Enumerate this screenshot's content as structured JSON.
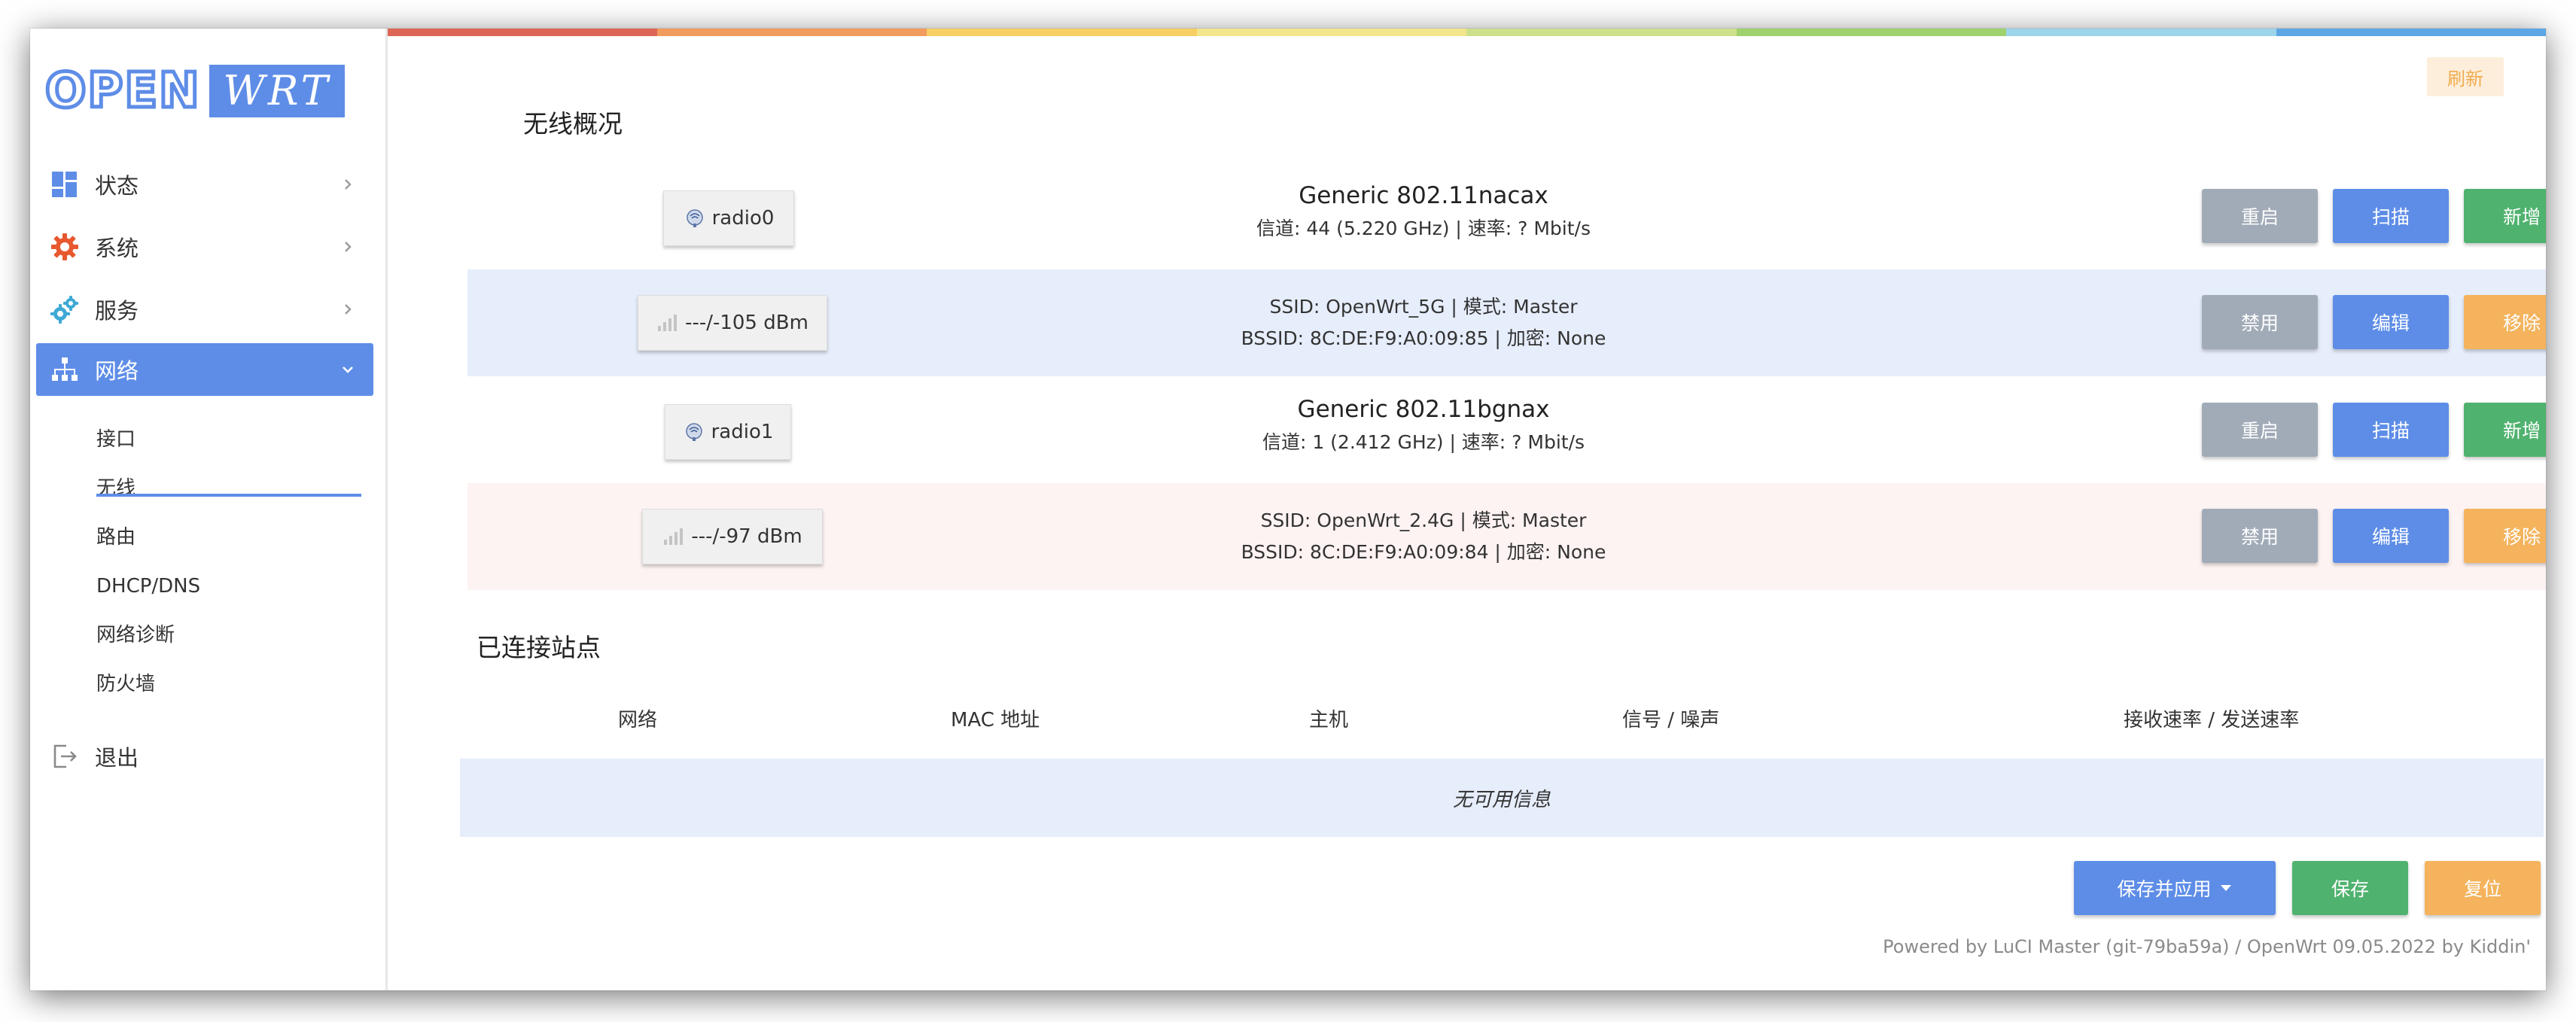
{
  "colors": {
    "accent": "#5e8de7",
    "gray_button": "#a1abb8",
    "green_button": "#4fb26e",
    "orange_button": "#f4b35c",
    "row_blue": "#e6edfb",
    "row_pink": "#fdf3f2",
    "stripe": [
      "#dd6555",
      "#f19b5c",
      "#f8cf65",
      "#f3e58c",
      "#cfe08c",
      "#9fd26c",
      "#9cd4ea",
      "#5da6e6"
    ]
  },
  "logo": {
    "open": "OPEN",
    "wrt": "WRT"
  },
  "sidebar": {
    "items": [
      {
        "label": "状态",
        "icon": "dashboard-icon"
      },
      {
        "label": "系统",
        "icon": "gear-icon"
      },
      {
        "label": "服务",
        "icon": "gears-icon"
      },
      {
        "label": "网络",
        "icon": "network-tree-icon",
        "active": true
      },
      {
        "label": "退出",
        "icon": "logout-icon"
      }
    ],
    "network_sub": [
      {
        "label": "接口"
      },
      {
        "label": "无线",
        "selected": true
      },
      {
        "label": "路由"
      },
      {
        "label": "DHCP/DNS"
      },
      {
        "label": "网络诊断"
      },
      {
        "label": "防火墙"
      }
    ]
  },
  "header": {
    "refresh": "刷新"
  },
  "wireless": {
    "title": "无线概况",
    "radios": [
      {
        "chip": "radio0",
        "line1": "Generic 802.11nacax",
        "line2": "信道: 44 (5.220 GHz) | 速率: ? Mbit/s",
        "buttons": [
          "重启",
          "扫描",
          "新增"
        ]
      },
      {
        "chip": "---/-105 dBm",
        "line1": "SSID: OpenWrt_5G | 模式: Master",
        "line2": "BSSID: 8C:DE:F9:A0:09:85 | 加密: None",
        "buttons": [
          "禁用",
          "编辑",
          "移除"
        ]
      },
      {
        "chip": "radio1",
        "line1": "Generic 802.11bgnax",
        "line2": "信道: 1 (2.412 GHz) | 速率: ? Mbit/s",
        "buttons": [
          "重启",
          "扫描",
          "新增"
        ]
      },
      {
        "chip": "---/-97 dBm",
        "line1": "SSID: OpenWrt_2.4G | 模式: Master",
        "line2": "BSSID: 8C:DE:F9:A0:09:84 | 加密: None",
        "buttons": [
          "禁用",
          "编辑",
          "移除"
        ]
      }
    ]
  },
  "stations": {
    "title": "已连接站点",
    "columns": [
      "网络",
      "MAC 地址",
      "主机",
      "信号 / 噪声",
      "接收速率 / 发送速率"
    ],
    "empty": "无可用信息"
  },
  "actions": {
    "save_apply": "保存并应用",
    "save": "保存",
    "reset": "复位"
  },
  "footer": "Powered by LuCI Master (git-79ba59a) / OpenWrt 09.05.2022 by Kiddin'"
}
